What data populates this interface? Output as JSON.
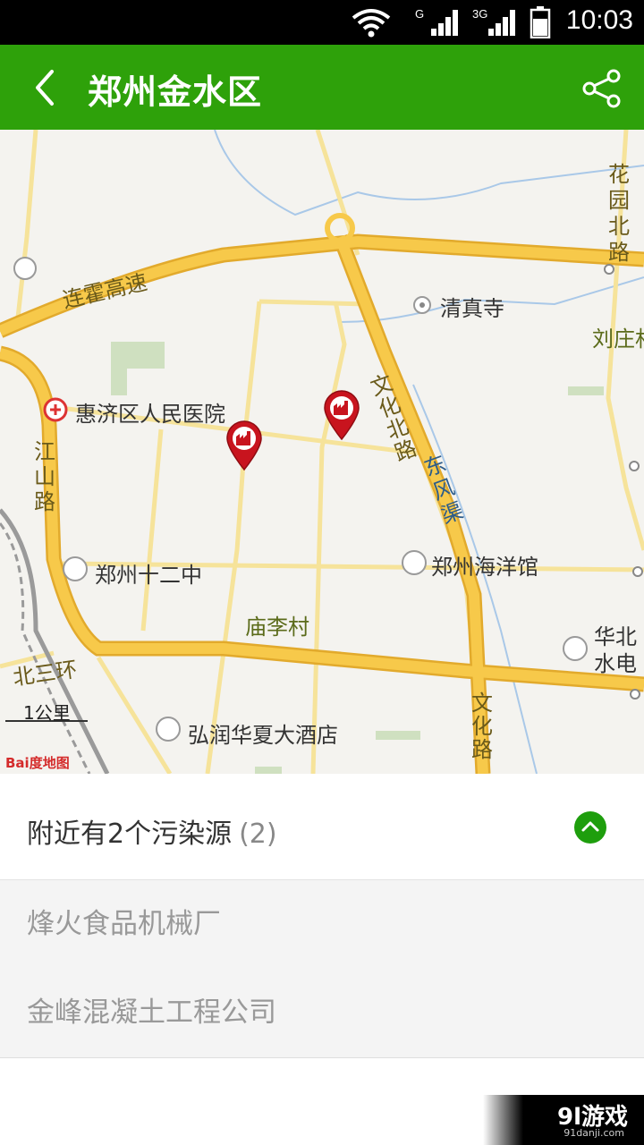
{
  "status_bar": {
    "time": "10:03",
    "net_g": "G",
    "net_3g": "3G"
  },
  "header": {
    "title": "郑州金水区"
  },
  "map": {
    "labels": {
      "expressway": "连霍高速",
      "mosque": "清真寺",
      "liuzhuang": "刘庄村",
      "huayuan_rd": "花园北路",
      "hospital": "惠济区人民医院",
      "wenhua_n_rd": "文化北路",
      "dongfeng_canal": "东风渠",
      "jiangshan_rd": "江山路",
      "school12": "郑州十二中",
      "aquarium": "郑州海洋馆",
      "miaoli": "庙李村",
      "north_ring": "北三环",
      "huabei": "华北水电",
      "wenhua_rd": "文化路",
      "hotel": "弘润华夏大酒店",
      "scale": "1公里",
      "baidu_logo": "Bai度地图"
    },
    "marker_count": 2
  },
  "pollution": {
    "title": "附近有2个污染源",
    "count": "(2)",
    "items": [
      "烽火食品机械厂",
      "金峰混凝土工程公司"
    ]
  },
  "watermark": {
    "text": "9l游戏",
    "sub": "91danji.com"
  },
  "colors": {
    "header": "#2ea10a",
    "toggle": "#1e9e0d",
    "marker": "#c8141e",
    "main_road": "#f7c94a"
  }
}
